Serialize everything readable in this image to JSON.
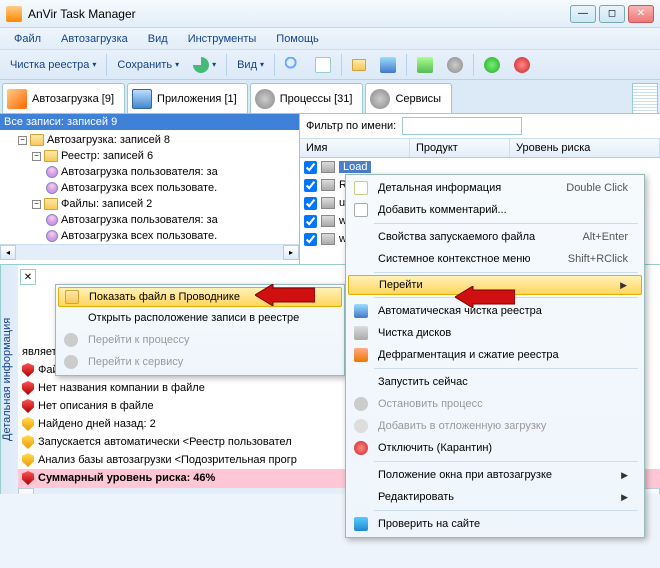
{
  "window": {
    "title": "AnVir Task Manager"
  },
  "menu": {
    "file": "Файл",
    "autorun": "Автозагрузка",
    "view": "Вид",
    "tools": "Инструменты",
    "help": "Помощь"
  },
  "toolbar": {
    "cleanreg": "Чистка реестра",
    "save": "Сохранить",
    "view": "Вид"
  },
  "tabs": {
    "autorun": "Автозагрузка  [9]",
    "apps": "Приложения  [1]",
    "proc": "Процессы  [31]",
    "svc": "Сервисы"
  },
  "tree": {
    "root": "Все записи: записей 9",
    "n1": "Автозагрузка: записей 8",
    "n2": "Реестр: записей 6",
    "n3": "Автозагрузка пользователя: за",
    "n4": "Автозагрузка всех пользовате.",
    "n5": "Файлы: записей 2",
    "n6": "Автозагрузка пользователя: за",
    "n7": "Автозагрузка всех пользовате."
  },
  "filter": {
    "label": "Фильтр по имени:",
    "placeholder": ""
  },
  "cols": {
    "name": "Имя",
    "product": "Продукт",
    "risk": "Уровень риска"
  },
  "rows": {
    "r1": "Load",
    "r2": "Run",
    "r3": "userin",
    "r4": "win.in",
    "r5": "win.in"
  },
  "detail": {
    "sidetab": "Детальная информация",
    "l0": "является окончательным вердиктом",
    "l1": "Файл не Майкрософта в папке Windows <matadd.e",
    "l2": "Нет названия компании в файле",
    "l3": "Нет описания в файле",
    "l4": "Найдено дней назад: 2",
    "l5": "Запускается автоматически <Реестр пользовател",
    "l6": "Анализ базы автозагрузки <Подозрительная прогр",
    "l7": "Суммарный уровень риска: 46%"
  },
  "ctx1": {
    "i1": "Показать файл в Проводнике",
    "i2": "Открыть расположение записи в реестре",
    "i3": "Перейти к процессу",
    "i4": "Перейти к сервису"
  },
  "ctx2": {
    "i1": "Детальная информация",
    "s1": "Double Click",
    "i2": "Добавить комментарий...",
    "i3": "Свойства запускаемого файла",
    "s3": "Alt+Enter",
    "i4": "Системное контекстное меню",
    "s4": "Shift+RClick",
    "i5": "Перейти",
    "i6": "Автоматическая чистка реестра",
    "i7": "Чистка дисков",
    "i8": "Дефрагментация и сжатие реестра",
    "i9": "Запустить сейчас",
    "i10": "Остановить процесс",
    "i11": "Добавить в отложенную загрузку",
    "i12": "Отключить (Карантин)",
    "i13": "Положение окна при автозагрузке",
    "i14": "Редактировать",
    "i15": "Проверить на сайте"
  }
}
